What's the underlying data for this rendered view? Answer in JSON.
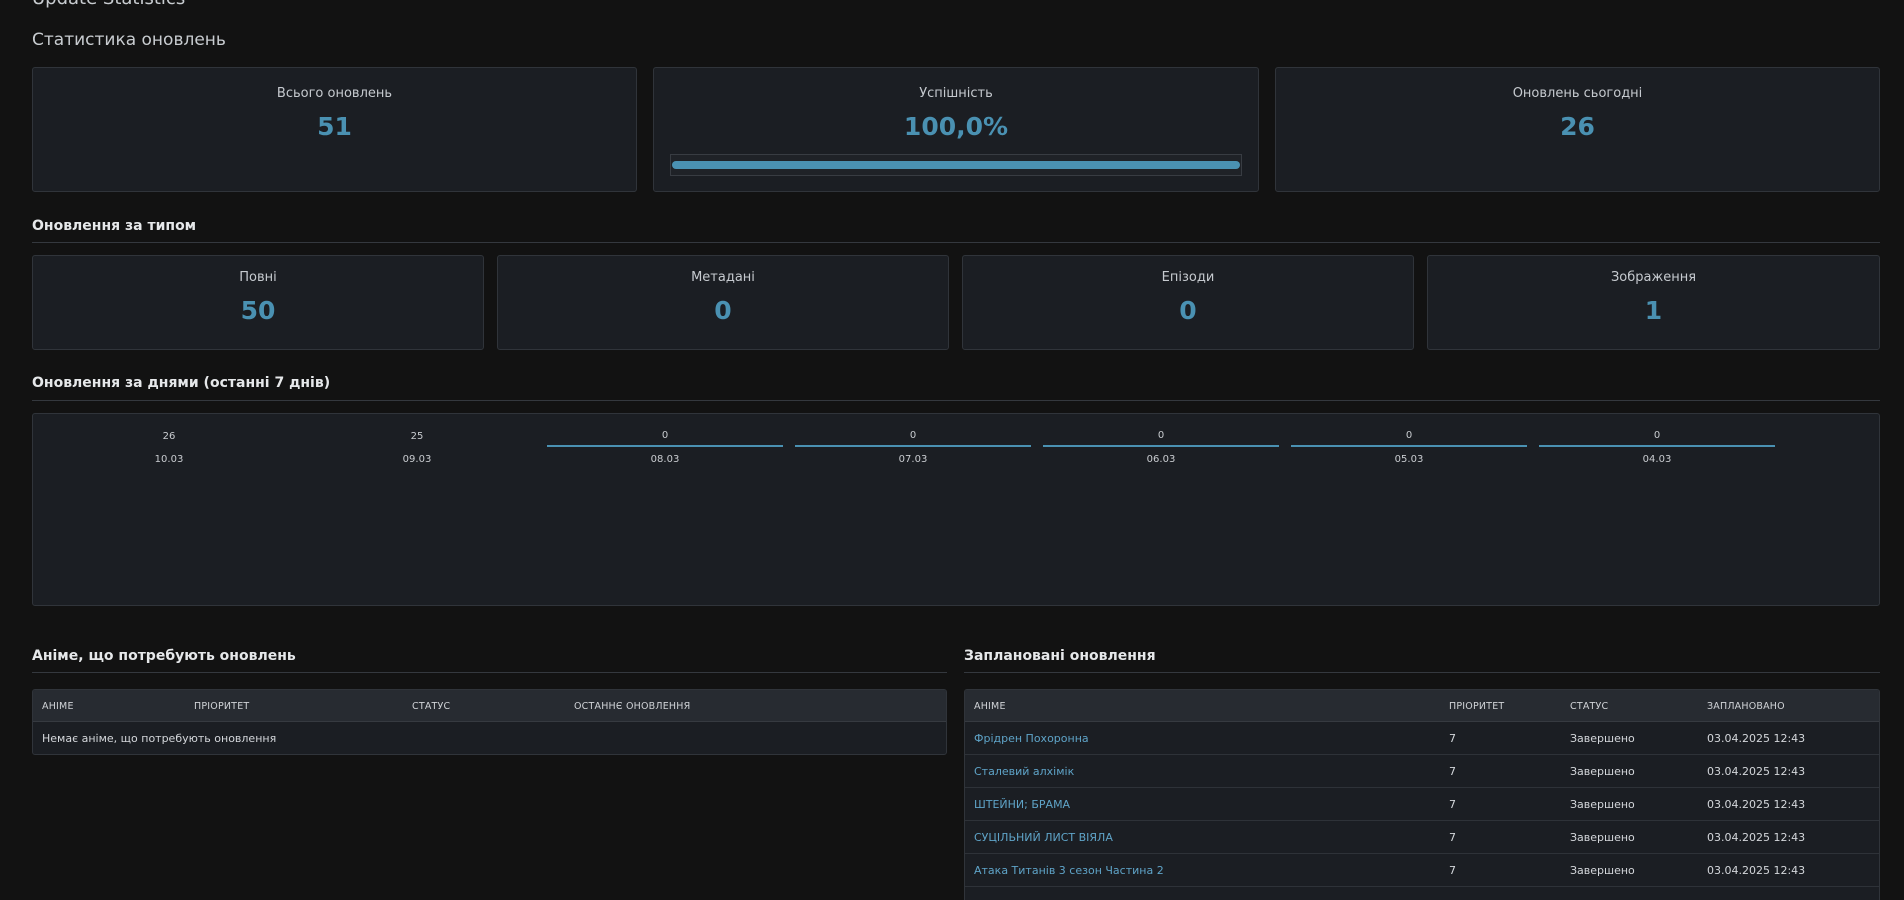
{
  "header": {
    "title": "Update Statistics",
    "subtitle": "Статистика оновлень"
  },
  "summary": {
    "total": {
      "label": "Всього оновлень",
      "value": "51"
    },
    "success": {
      "label": "Успішність",
      "value": "100,0%",
      "progress_fraction": 1.0
    },
    "today": {
      "label": "Оновлень сьогодні",
      "value": "26"
    }
  },
  "by_type": {
    "title": "Оновлення за типом",
    "cards": [
      {
        "label": "Повні",
        "value": "50"
      },
      {
        "label": "Метадані",
        "value": "0"
      },
      {
        "label": "Епізоди",
        "value": "0"
      },
      {
        "label": "Зображення",
        "value": "1"
      }
    ]
  },
  "by_day": {
    "title": "Оновлення за днями (останні 7 днів)"
  },
  "chart_data": {
    "type": "bar",
    "categories": [
      "10.03",
      "09.03",
      "08.03",
      "07.03",
      "06.03",
      "05.03",
      "04.03"
    ],
    "values": [
      26,
      25,
      0,
      0,
      0,
      0,
      0
    ],
    "xlabel": "",
    "ylabel": "",
    "grid": false,
    "bar_color": "#4a91b2"
  },
  "needs_update": {
    "title": "Аніме, що потребують оновлень",
    "columns": [
      "АНІМЕ",
      "ПРІОРИТЕТ",
      "СТАТУС",
      "ОСТАННЄ ОНОВЛЕННЯ"
    ],
    "empty_text": "Немає аніме, що потребують оновлення"
  },
  "scheduled": {
    "title": "Заплановані оновлення",
    "columns": [
      "АНІМЕ",
      "ПРІОРИТЕТ",
      "СТАТУС",
      "ЗАПЛАНОВАНО"
    ],
    "rows": [
      {
        "anime": "Фрідрен Похоронна",
        "priority": "7",
        "status": "Завершено",
        "scheduled": "03.04.2025 12:43"
      },
      {
        "anime": "Сталевий алхімік",
        "priority": "7",
        "status": "Завершено",
        "scheduled": "03.04.2025 12:43"
      },
      {
        "anime": "ШТЕЙНИ; БРАМА",
        "priority": "7",
        "status": "Завершено",
        "scheduled": "03.04.2025 12:43"
      },
      {
        "anime": "СУЦІЛЬНИЙ ЛИСТ ВІЯЛА",
        "priority": "7",
        "status": "Завершено",
        "scheduled": "03.04.2025 12:43"
      },
      {
        "anime": "Атака Титанів 3 сезон Частина 2",
        "priority": "7",
        "status": "Завершено",
        "scheduled": "03.04.2025 12:43"
      }
    ]
  },
  "colors": {
    "background": "#121212",
    "card": "#1b1e23",
    "accent": "#4a91b2",
    "link": "#5fa4c8"
  }
}
